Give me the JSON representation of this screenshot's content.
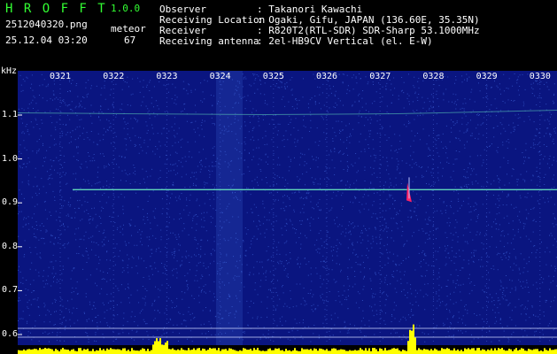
{
  "app": {
    "name": "H R O F F T",
    "version": "1.0.0"
  },
  "capture": {
    "filename": "2512040320.png",
    "datetime": "25.12.04 03:20",
    "count_label": "meteor",
    "count_value": "67"
  },
  "info": [
    {
      "label": "Observer",
      "value": ": Takanori Kawachi"
    },
    {
      "label": "Receiving Location",
      "value": ": Ogaki, Gifu, JAPAN (136.60E, 35.35N)"
    },
    {
      "label": "Receiver",
      "value": ": R820T2(RTL-SDR) SDR-Sharp 53.1000MHz"
    },
    {
      "label": "Receiving antenna",
      "value": ": 2el-HB9CV Vertical (el. E-W)"
    }
  ],
  "spectrogram": {
    "y_unit": "kHz",
    "y_ticks": [
      "1.1",
      "1.0",
      "0.9",
      "0.8",
      "0.7",
      "0.6"
    ],
    "x_ticks": [
      "0321",
      "0322",
      "0323",
      "0324",
      "0325",
      "0326",
      "0327",
      "0328",
      "0329",
      "0330"
    ],
    "carrier_khz": 0.93,
    "upper_trace_khz": 1.105,
    "meteor_echo": {
      "time": "0327.6",
      "freq_khz": 0.93
    },
    "colors": {
      "background": "#0a1580",
      "noise": "#3b5fd6",
      "trace": "#5fd4b8",
      "echo": "#ff2266",
      "histogram": "#ffff00",
      "axis_text": "#ffffff",
      "header_green": "#33ff33"
    }
  }
}
